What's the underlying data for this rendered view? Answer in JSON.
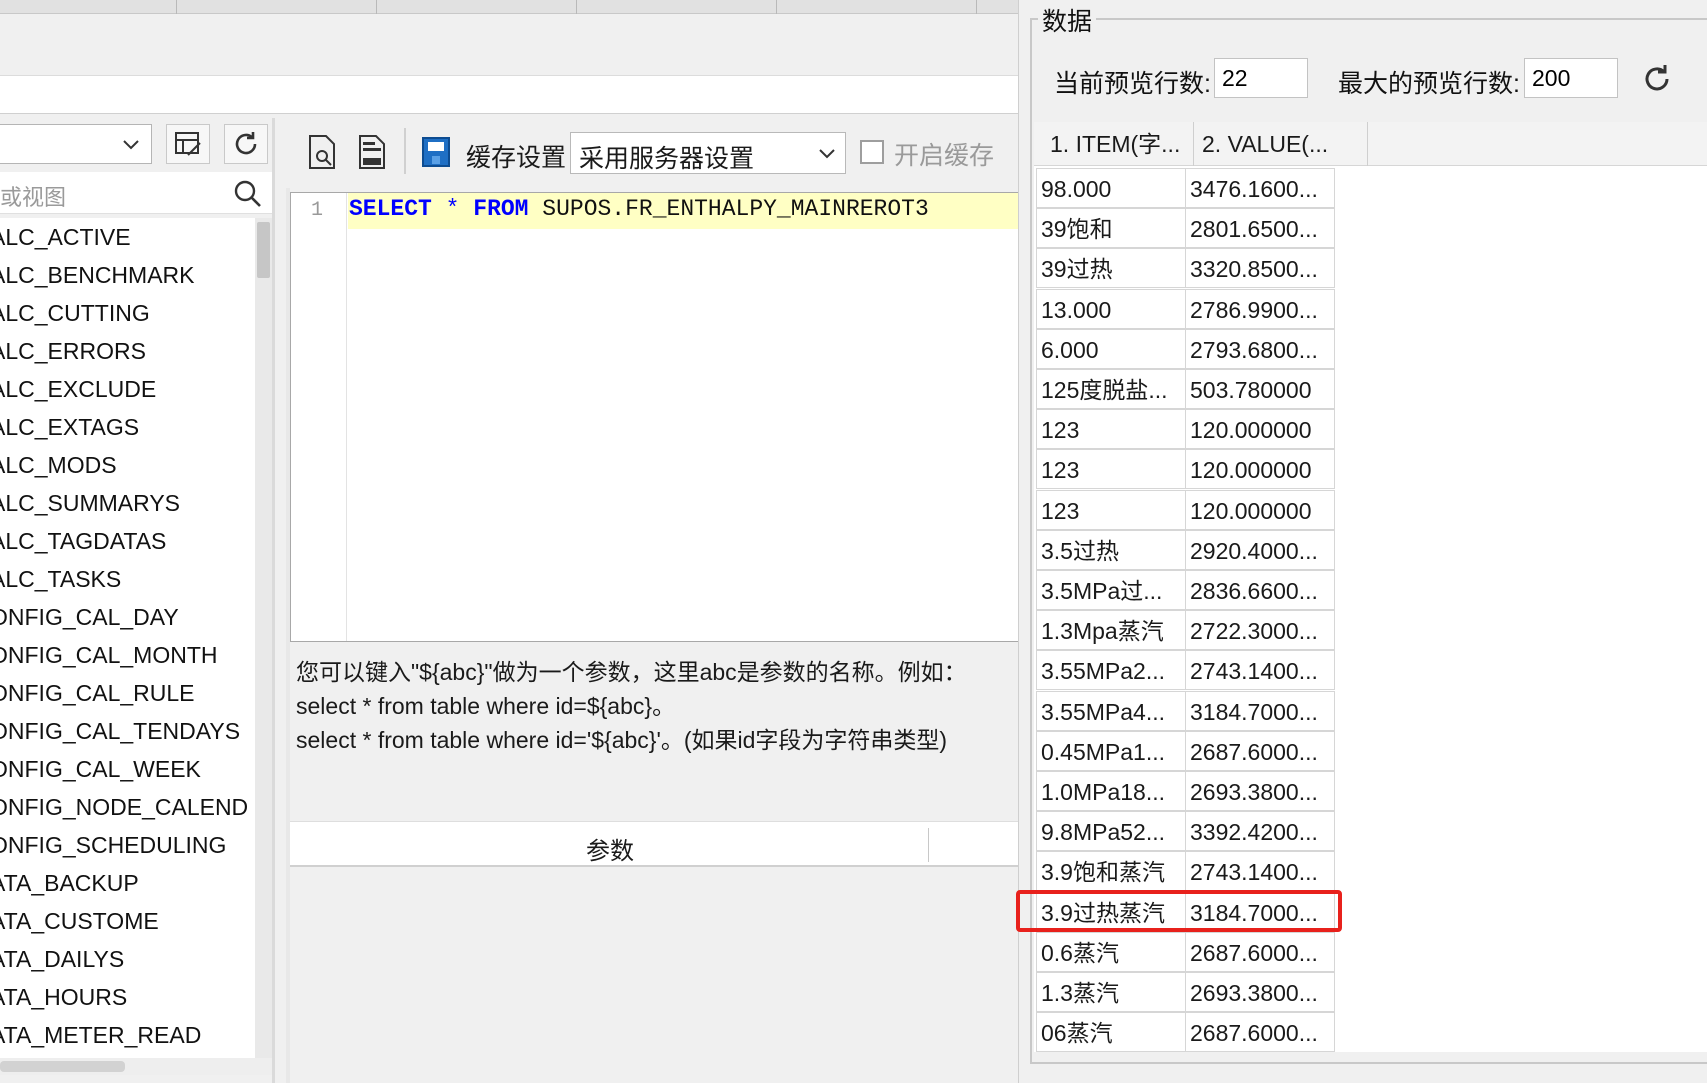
{
  "tree": {
    "search_placeholder": "或视图",
    "items": [
      "ALC_ACTIVE",
      "ALC_BENCHMARK",
      "ALC_CUTTING",
      "ALC_ERRORS",
      "ALC_EXCLUDE",
      "ALC_EXTAGS",
      "ALC_MODS",
      "ALC_SUMMARYS",
      "ALC_TAGDATAS",
      "ALC_TASKS",
      "ONFIG_CAL_DAY",
      "ONFIG_CAL_MONTH",
      "ONFIG_CAL_RULE",
      "ONFIG_CAL_TENDAYS",
      "ONFIG_CAL_WEEK",
      "ONFIG_NODE_CALEND",
      "ONFIG_SCHEDULING",
      "ATA_BACKUP",
      "ATA_CUSTOME",
      "ATA_DAILYS",
      "ATA_HOURS",
      "ATA_METER_READ"
    ]
  },
  "sql": {
    "toolbar": {
      "cache_label": "缓存设置",
      "cache_value": "采用服务器设置",
      "enable_cache_label": "开启缓存"
    },
    "editor": {
      "line_number": "1",
      "kw_select": "SELECT",
      "star": "*",
      "kw_from": "FROM",
      "table": "SUPOS.FR_ENTHALPY_MAINREROT3"
    },
    "hint_lines": [
      "您可以键入\"${abc}\"做为一个参数，这里abc是参数的名称。例如：",
      "select * from table where id=${abc}。",
      "select * from table where id='${abc}'。(如果id字段为字符串类型)"
    ],
    "params_header": "参数"
  },
  "data_panel": {
    "title": "数据",
    "current_preview_label": "当前预览行数:",
    "current_preview_value": "22",
    "max_preview_label": "最大的预览行数:",
    "max_preview_value": "200",
    "columns": [
      "1. ITEM(字...",
      "2. VALUE(..."
    ],
    "rows": [
      [
        "98.000",
        "3476.1600..."
      ],
      [
        "39饱和",
        "2801.6500..."
      ],
      [
        "39过热",
        "3320.8500..."
      ],
      [
        "13.000",
        "2786.9900..."
      ],
      [
        "6.000",
        "2793.6800..."
      ],
      [
        "125度脱盐...",
        "503.780000"
      ],
      [
        "123",
        "120.000000"
      ],
      [
        "123",
        "120.000000"
      ],
      [
        "123",
        "120.000000"
      ],
      [
        "3.5过热",
        "2920.4000..."
      ],
      [
        "3.5MPa过...",
        "2836.6600..."
      ],
      [
        "1.3Mpa蒸汽",
        "2722.3000..."
      ],
      [
        "3.55MPa2...",
        "2743.1400..."
      ],
      [
        "3.55MPa4...",
        "3184.7000..."
      ],
      [
        "0.45MPa1...",
        "2687.6000..."
      ],
      [
        "1.0MPa18...",
        "2693.3800..."
      ],
      [
        "9.8MPa52...",
        "3392.4200..."
      ],
      [
        "3.9饱和蒸汽",
        "2743.1400..."
      ],
      [
        "3.9过热蒸汽",
        "3184.7000..."
      ],
      [
        "0.6蒸汽",
        "2687.6000..."
      ],
      [
        "1.3蒸汽",
        "2693.3800..."
      ],
      [
        "06蒸汽",
        "2687.6000..."
      ]
    ],
    "highlighted_row": 18,
    "highlight_color": "#e8211c"
  },
  "colors": {
    "sql_keyword": "#0000ff",
    "current_line_bg": "#ffffc4"
  }
}
